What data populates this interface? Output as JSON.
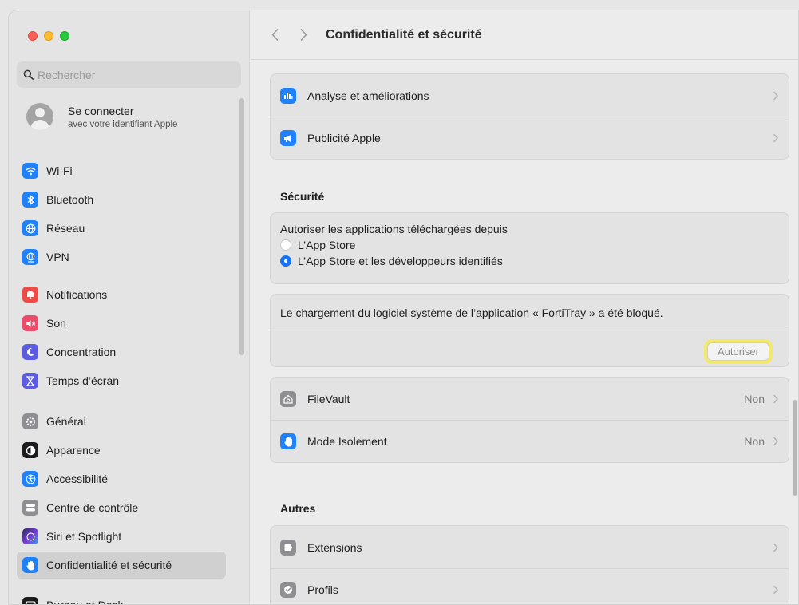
{
  "window": {
    "title": "Confidentialité et sécurité"
  },
  "colors": {
    "accent": "#1672f3",
    "traffic_red": "#ff5f57",
    "traffic_yellow": "#febc2e",
    "traffic_green": "#28c840"
  },
  "search": {
    "placeholder": "Rechercher",
    "value": ""
  },
  "account": {
    "title": "Se connecter",
    "subtitle": "avec votre identifiant Apple"
  },
  "sidebar": {
    "items": [
      {
        "label": "Wi-Fi",
        "icon": "wifi-icon",
        "color": "#1f82fb"
      },
      {
        "label": "Bluetooth",
        "icon": "bluetooth-icon",
        "color": "#1f82fb"
      },
      {
        "label": "Réseau",
        "icon": "globe-icon",
        "color": "#1f82fb"
      },
      {
        "label": "VPN",
        "icon": "vpn-globe-icon",
        "color": "#1f82fb"
      },
      {
        "label": "Notifications",
        "icon": "bell-icon",
        "color": "#ee4b47"
      },
      {
        "label": "Son",
        "icon": "speaker-icon",
        "color": "#ee4b6b"
      },
      {
        "label": "Concentration",
        "icon": "moon-icon",
        "color": "#5c5ce0"
      },
      {
        "label": "Temps d’écran",
        "icon": "hourglass-icon",
        "color": "#5c5ce0"
      },
      {
        "label": "Général",
        "icon": "gear-icon",
        "color": "#8e8e93"
      },
      {
        "label": "Apparence",
        "icon": "appearance-icon",
        "color": "#1c1c1e"
      },
      {
        "label": "Accessibilité",
        "icon": "accessibility-icon",
        "color": "#1f82fb"
      },
      {
        "label": "Centre de contrôle",
        "icon": "control-center-icon",
        "color": "#8e8e93"
      },
      {
        "label": "Siri et Spotlight",
        "icon": "siri-icon",
        "color": "#6d4bd6"
      },
      {
        "label": "Confidentialité et sécurité",
        "icon": "hand-icon",
        "color": "#1f82fb",
        "selected": true
      },
      {
        "label": "Bureau et Dock",
        "icon": "dock-icon",
        "color": "#1c1c1e"
      }
    ]
  },
  "main": {
    "top_card": [
      {
        "label": "Analyse et améliorations",
        "icon": "chart-bars-icon"
      },
      {
        "label": "Publicité Apple",
        "icon": "megaphone-icon"
      }
    ],
    "security": {
      "title": "Sécurité",
      "allow_apps_label": "Autoriser les applications téléchargées depuis",
      "options": [
        {
          "label": "L’App Store",
          "selected": false
        },
        {
          "label": "L’App Store et les développeurs identifiés",
          "selected": true
        }
      ],
      "blocked_message": "Le chargement du logiciel système de l’application « FortiTray » a été bloqué.",
      "allow_button": "Autoriser"
    },
    "security_rows": [
      {
        "label": "FileVault",
        "value": "Non",
        "icon": "filevault-icon"
      },
      {
        "label": "Mode Isolement",
        "value": "Non",
        "icon": "hand-icon"
      }
    ],
    "others": {
      "title": "Autres",
      "rows": [
        {
          "label": "Extensions",
          "icon": "extensions-icon"
        },
        {
          "label": "Profils",
          "icon": "profiles-check-icon"
        }
      ]
    }
  }
}
